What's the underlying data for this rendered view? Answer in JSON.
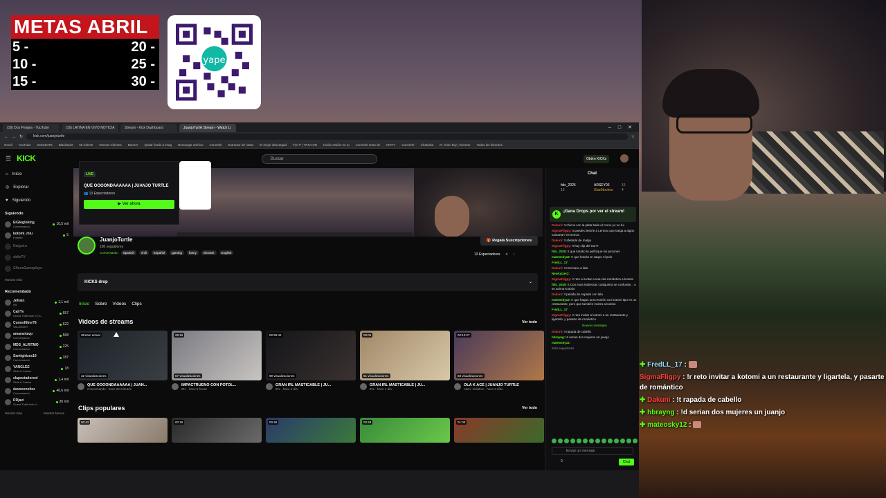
{
  "goals": {
    "title": "METAS ABRIL",
    "rows": [
      {
        "left": "5 -",
        "right": "20 -"
      },
      {
        "left": "10 -",
        "right": "25 -"
      },
      {
        "left": "15 -",
        "right": "30 -"
      }
    ],
    "qr_brand": "yape"
  },
  "browser": {
    "tabs": [
      "(16) Dos Pelajes - YouTube",
      "(16) LATINA EN VIVO NOTICIA",
      "Stream - Kick Dashboard",
      "JuanjoTurtle Stream - Watch Li"
    ],
    "window_controls": [
      "–",
      "□",
      "✕"
    ],
    "url": "kick.com/juanjoturtle",
    "bookmarks": [
      "Gmail",
      "YouTube",
      "SOCIBATE",
      "Blacksaint",
      "Mi Cliente",
      "Interact Clientes",
      "Banner",
      "Quitar fondo a imag",
      "Descargar archivo",
      "Convertir",
      "Extractor de notas",
      "El mejor descargad",
      "Fire P | TRIVI.ON",
      "Iniciar sesión en tu",
      "Convertir texto de",
      "KRITY",
      "Convertir",
      "Chaturba",
      "R. Chec tiny | Inventor",
      "Todos los favoritos"
    ]
  },
  "kick": {
    "logo": "KICK",
    "search_placeholder": "Buscar",
    "get_kicks": "Obtén KICKs",
    "nav": [
      "Inicio",
      "Explorar",
      "Siguiendo"
    ],
    "following_label": "Siguiendo",
    "following": [
      {
        "name": "ElGlogloking",
        "game": "Conversando",
        "viewers": "10,5 mil"
      },
      {
        "name": "kotomi_miu",
        "game": "Fortnite",
        "viewers": "5"
      },
      {
        "name": "Daigot.o",
        "game": "",
        "viewers": ""
      },
      {
        "name": "zirlisTV",
        "game": "",
        "viewers": ""
      },
      {
        "name": "GllussGameplays",
        "game": "",
        "viewers": ""
      }
    ],
    "show_more": "Mostrar más",
    "recommended_label": "Recomendado",
    "recommended": [
      {
        "name": "Jefrain",
        "game": "IRL",
        "viewers": "1,1 mil"
      },
      {
        "name": "CalrTv",
        "game": "Grand Theft Auto V (G...",
        "viewers": "657"
      },
      {
        "name": "Cursedfiber78",
        "game": "VALORANT",
        "viewers": "622"
      },
      {
        "name": "amarantavp",
        "game": "Conversando",
        "viewers": "568"
      },
      {
        "name": "MDS_ALRITMO",
        "game": "Conversando",
        "viewers": "225"
      },
      {
        "name": "Santigirizes19",
        "game": "Conversando",
        "viewers": "187"
      },
      {
        "name": "YANGLEE",
        "game": "Slots & Casino",
        "viewers": "18"
      },
      {
        "name": "elapostadorcol",
        "game": "Slots & Casino",
        "viewers": "1,4 mil"
      },
      {
        "name": "davooxneitez",
        "game": "Conversando",
        "viewers": "46,6 mil"
      },
      {
        "name": "RDjavi",
        "game": "Grand Theft Auto V...",
        "viewers": "30 mil"
      }
    ],
    "show_more2": "Mostrar más",
    "show_less": "Mostrar Menos",
    "live_card": {
      "badge": "LIVE",
      "title": "QUE OOOONDAAAAAA | JUANJO TURTLE",
      "viewers": "13 Espectadores",
      "button": "Ver ahora"
    },
    "channel": {
      "name": "JuanjoTurtle",
      "followers": "180 seguidores",
      "category": "Conversando",
      "tags": [
        "Spanish",
        "chill",
        "Español",
        "gaming",
        "funny",
        "Shooter",
        "English"
      ],
      "subscribe": "Regala Suscripciones",
      "viewers": "13 Espectadores",
      "share": "<",
      "menu": "⁝"
    },
    "drops_label": "KICKS drop",
    "subtabs": [
      "Inicio",
      "Sobre",
      "Videos",
      "Clips"
    ],
    "videos_heading": "Videos de streams",
    "see_all": "Ver todo",
    "videos": [
      {
        "dur": "Stream actual",
        "views": "32 visualizaciones",
        "title": "QUE OOOONDAAAAAA | JUAN...",
        "meta": "Conversando · hace 29 minutos"
      },
      {
        "dur": "28:16",
        "views": "67 visualizaciones",
        "title": "IMPACTRUENO CON POTOL...",
        "meta": "IRL · hace 5 horas"
      },
      {
        "dur": "02:59:42",
        "views": "99 visualizaciones",
        "title": "GRAN IRL MASTICABLE | JU...",
        "meta": "IRL · hace 1 día"
      },
      {
        "dur": "09:05",
        "views": "61 visualizaciones",
        "title": "GRAN IRL MASTICABLE | JU...",
        "meta": "IRL · hace 1 día"
      },
      {
        "dur": "02:12:27",
        "views": "58 visualizaciones",
        "title": "OLA K ACE | JUANJO TURTLE",
        "meta": "Alien: Isolation · hace 3 días"
      }
    ],
    "clips_heading": "Clips populares",
    "clips": [
      {
        "dur": "00:43"
      },
      {
        "dur": "00:19"
      },
      {
        "dur": "00:48"
      },
      {
        "dur": "00:49"
      },
      {
        "dur": "01:00"
      }
    ],
    "chat": {
      "title": "Chat",
      "leaderboard": [
        {
          "name": "fdic_2025",
          "value": "16"
        },
        {
          "name": "ARSEY03",
          "value": "16"
        },
        {
          "name": "GianNoches",
          "value": "4"
        }
      ],
      "drops_banner": "¡Gana Drops por ver el stream!",
      "messages": [
        {
          "user": "Dakuni",
          "text": "!t chicos con la plata baila el mono yo no fui",
          "green": false
        },
        {
          "user": "SigmaFligpy",
          "text": "!t puedes decirle a Lennox que traiga a algún cantante? es iennox",
          "green": false
        },
        {
          "user": "Dakuni",
          "text": "!t afeitada de malga",
          "green": false
        },
        {
          "user": "SigmaFligpy",
          "text": "!t hay clip del Sur!?",
          "green": false
        },
        {
          "user": "fdic_2025",
          "text": "!t que kotoko te peñizque los pezones",
          "green": true
        },
        {
          "user": "mateosky12",
          "text": "!r que kotoko te saque el polo",
          "green": true
        },
        {
          "user": "FredLL_17",
          "text": "",
          "green": true
        },
        {
          "user": "Dakuni",
          "text": "!t reto baso a lala",
          "green": false
        },
        {
          "user": "NeoKaizer2",
          "text": "",
          "green": true
        },
        {
          "user": "SigmaFligpy",
          "text": "!r reto a invitar a una cita romántica a kotomi",
          "green": false
        },
        {
          "user": "fdic_2025",
          "text": "!t Con esas indirectas cualquiera se confunde... o se anima Kotoko",
          "green": true
        },
        {
          "user": "Dakuni",
          "text": "!t pelada de espada con lala",
          "green": false
        },
        {
          "user": "mateosky12",
          "text": "!r que hagas una reunión con kotomi tipo en un restaurante, pero que también invites a kotoko",
          "green": true
        },
        {
          "user": "FredLL_17",
          "text": "",
          "green": true
        },
        {
          "user": "SigmaFligpy",
          "text": "!r reto invitar a kotomi a un restaurante y ligartela, y pasarte de romántico",
          "green": false
        }
      ],
      "new_messages": "Nuevos mensajes",
      "messages_after": [
        {
          "user": "Dakuni",
          "text": "!t rapada de cabello",
          "green": false
        },
        {
          "user": "hbrayng",
          "text": "!d serian dos mujeres un juanjo",
          "green": true
        },
        {
          "user": "mateosky12",
          "text": "",
          "green": true
        }
      ],
      "followers_only": "Solo seguidores",
      "input_placeholder": "Enviar un mensaje",
      "kicks": "0",
      "send": "Chat"
    }
  },
  "overlay_chat": [
    {
      "user": "FredLL_17",
      "text": "",
      "user_color": "#8fd7ff"
    },
    {
      "user": "SigmaFligpy",
      "text": "!r reto invitar a kotomi a un restaurante y ligartela, y pasarte de romántico",
      "user_color": "#ff3b3b"
    },
    {
      "user": "Dakuni",
      "text": "!t rapada de cabello",
      "user_color": "#ff3b3b"
    },
    {
      "user": "hbrayng",
      "text": "!d serian dos mujeres un juanjo",
      "user_color": "#53fc18"
    },
    {
      "user": "mateosky12",
      "text": "",
      "user_color": "#53fc18"
    }
  ],
  "colors": {
    "kick_green": "#53fc18",
    "goals_red": "#c4141c"
  }
}
